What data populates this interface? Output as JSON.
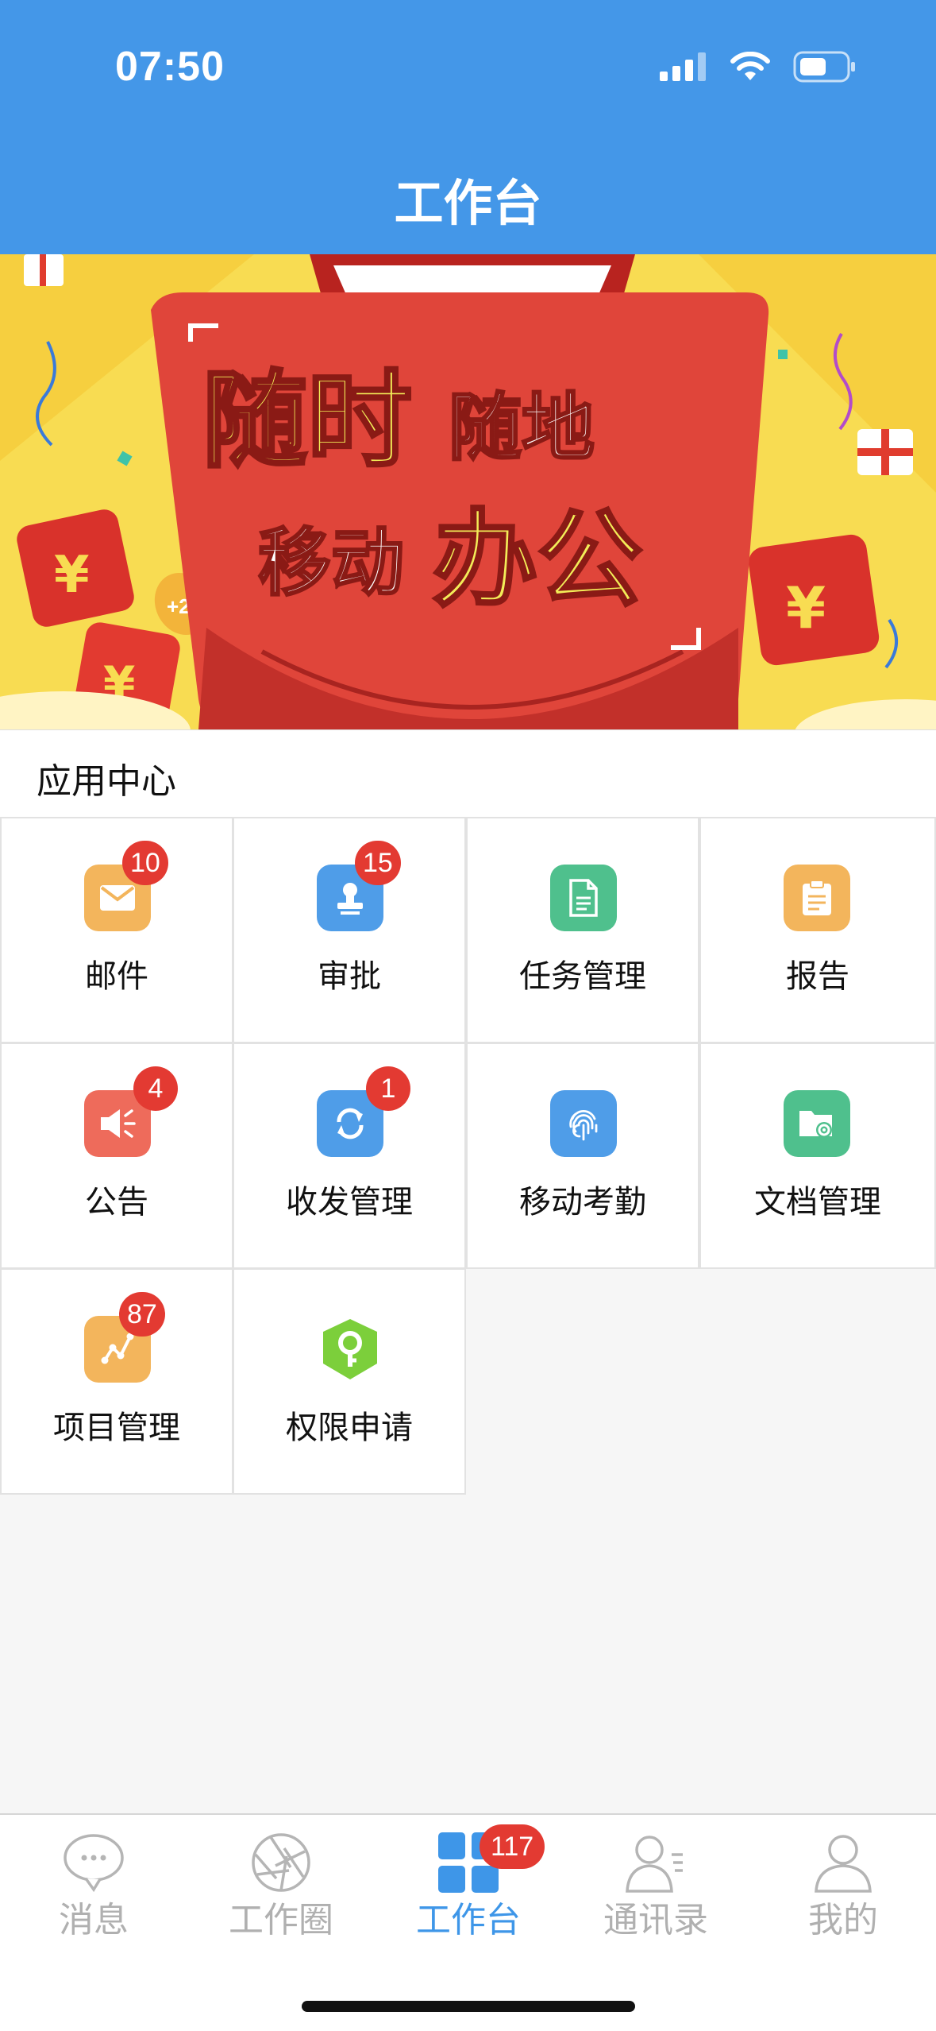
{
  "status_bar": {
    "time": "07:50",
    "icons": [
      "signal-icon",
      "wifi-icon",
      "battery-icon"
    ]
  },
  "header": {
    "title": "工作台"
  },
  "banner": {
    "line1_big": "随时",
    "line1_small": "随地",
    "line2_small": "移动",
    "line2_big": "办公",
    "tag": "+20"
  },
  "app_center": {
    "title": "应用中心",
    "apps": [
      {
        "label": "邮件",
        "badge": "10",
        "icon": "mail-icon",
        "color": "#f3b55c"
      },
      {
        "label": "审批",
        "badge": "15",
        "icon": "stamp-icon",
        "color": "#4f9de8"
      },
      {
        "label": "任务管理",
        "badge": "",
        "icon": "document-icon",
        "color": "#4fc08d"
      },
      {
        "label": "报告",
        "badge": "",
        "icon": "clipboard-icon",
        "color": "#f3b55c"
      },
      {
        "label": "公告",
        "badge": "4",
        "icon": "megaphone-icon",
        "color": "#ee6b5b"
      },
      {
        "label": "收发管理",
        "badge": "1",
        "icon": "sync-icon",
        "color": "#4f9de8"
      },
      {
        "label": "移动考勤",
        "badge": "",
        "icon": "fingerprint-icon",
        "color": "#4f9de8"
      },
      {
        "label": "文档管理",
        "badge": "",
        "icon": "folder-settings-icon",
        "color": "#4fc08d"
      },
      {
        "label": "项目管理",
        "badge": "87",
        "icon": "project-icon",
        "color": "#f3b55c"
      },
      {
        "label": "权限申请",
        "badge": "",
        "icon": "key-shield-icon",
        "color": "#7ccf3b"
      }
    ]
  },
  "tabbar": {
    "tabs": [
      {
        "label": "消息",
        "icon": "chat-bubble-icon",
        "badge": ""
      },
      {
        "label": "工作圈",
        "icon": "aperture-icon",
        "badge": ""
      },
      {
        "label": "工作台",
        "icon": "grid-icon",
        "badge": "117"
      },
      {
        "label": "通讯录",
        "icon": "contacts-icon",
        "badge": ""
      },
      {
        "label": "我的",
        "icon": "person-icon",
        "badge": ""
      }
    ],
    "active_index": 2
  }
}
